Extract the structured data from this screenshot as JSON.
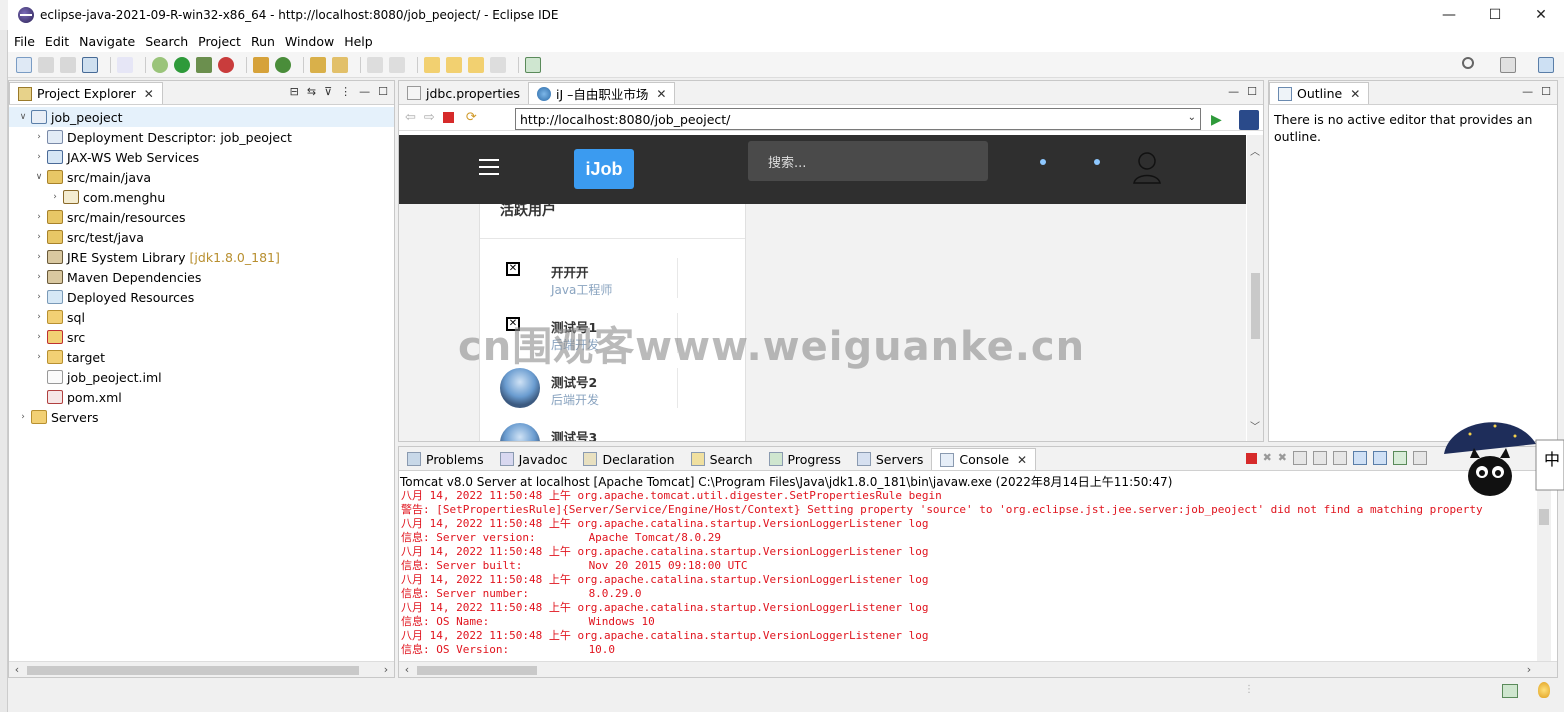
{
  "window": {
    "title": "eclipse-java-2021-09-R-win32-x86_64 - http://localhost:8080/job_peoject/ - Eclipse IDE",
    "minimize": "—",
    "maximize": "☐",
    "close": "✕"
  },
  "menu": [
    "File",
    "Edit",
    "Navigate",
    "Search",
    "Project",
    "Run",
    "Window",
    "Help"
  ],
  "project_explorer": {
    "tab_label": "Project Explorer",
    "items": [
      {
        "label": "job_peoject",
        "depth": 0,
        "expanded": true,
        "selected": true,
        "icon": "web-project-icon"
      },
      {
        "label": "Deployment Descriptor: job_peoject",
        "depth": 1,
        "expanded": false,
        "icon": "deployment-descriptor-icon"
      },
      {
        "label": "JAX-WS Web Services",
        "depth": 1,
        "expanded": false,
        "icon": "web-services-icon"
      },
      {
        "label": "src/main/java",
        "depth": 1,
        "expanded": true,
        "icon": "source-folder-icon"
      },
      {
        "label": "com.menghu",
        "depth": 2,
        "expanded": false,
        "icon": "package-icon"
      },
      {
        "label": "src/main/resources",
        "depth": 1,
        "expanded": false,
        "icon": "source-folder-icon"
      },
      {
        "label": "src/test/java",
        "depth": 1,
        "expanded": false,
        "icon": "source-folder-icon"
      },
      {
        "label": "JRE System Library",
        "suffix": "[jdk1.8.0_181]",
        "depth": 1,
        "expanded": false,
        "icon": "library-icon"
      },
      {
        "label": "Maven Dependencies",
        "depth": 1,
        "expanded": false,
        "icon": "library-icon"
      },
      {
        "label": "Deployed Resources",
        "depth": 1,
        "expanded": false,
        "icon": "deployed-resources-icon"
      },
      {
        "label": "sql",
        "depth": 1,
        "expanded": false,
        "icon": "folder-icon"
      },
      {
        "label": "src",
        "depth": 1,
        "expanded": false,
        "icon": "folder-error-icon"
      },
      {
        "label": "target",
        "depth": 1,
        "expanded": false,
        "icon": "folder-icon"
      },
      {
        "label": "job_peoject.iml",
        "depth": 1,
        "leaf": true,
        "icon": "file-icon"
      },
      {
        "label": "pom.xml",
        "depth": 1,
        "leaf": true,
        "icon": "xml-file-icon"
      },
      {
        "label": "Servers",
        "depth": 0,
        "expanded": false,
        "icon": "folder-icon"
      }
    ]
  },
  "editor": {
    "tabs": [
      {
        "label": "jdbc.properties",
        "active": false
      },
      {
        "label": "iJ –自由职业市场",
        "active": true
      }
    ],
    "url": "http://localhost:8080/job_peoject/",
    "page": {
      "logo": "iJob",
      "search_placeholder": "搜索...",
      "section_title": "活跃用户",
      "users": [
        {
          "name": "开开开",
          "job": "Java工程师",
          "avatar": "broken"
        },
        {
          "name": "测试号1",
          "job": "后端开发",
          "avatar": "broken"
        },
        {
          "name": "测试号2",
          "job": "后端开发",
          "avatar": "photo"
        },
        {
          "name": "测试号3",
          "job": "",
          "avatar": "photo"
        }
      ]
    }
  },
  "outline": {
    "tab_label": "Outline",
    "message": "There is no active editor that provides an outline."
  },
  "bottom": {
    "tabs": [
      "Problems",
      "Javadoc",
      "Declaration",
      "Search",
      "Progress",
      "Servers",
      "Console"
    ],
    "active_tab": "Console",
    "console_header": "Tomcat v8.0 Server at localhost [Apache Tomcat] C:\\Program Files\\Java\\jdk1.8.0_181\\bin\\javaw.exe  (2022年8月14日上午11:50:47)",
    "lines": [
      "八月 14, 2022 11:50:48 上午 org.apache.tomcat.util.digester.SetPropertiesRule begin",
      "警告: [SetPropertiesRule]{Server/Service/Engine/Host/Context} Setting property 'source' to 'org.eclipse.jst.jee.server:job_peoject' did not find a matching property",
      "八月 14, 2022 11:50:48 上午 org.apache.catalina.startup.VersionLoggerListener log",
      "信息: Server version:        Apache Tomcat/8.0.29",
      "八月 14, 2022 11:50:48 上午 org.apache.catalina.startup.VersionLoggerListener log",
      "信息: Server built:          Nov 20 2015 09:18:00 UTC",
      "八月 14, 2022 11:50:48 上午 org.apache.catalina.startup.VersionLoggerListener log",
      "信息: Server number:         8.0.29.0",
      "八月 14, 2022 11:50:48 上午 org.apache.catalina.startup.VersionLoggerListener log",
      "信息: OS Name:               Windows 10",
      "八月 14, 2022 11:50:48 上午 org.apache.catalina.startup.VersionLoggerListener log",
      "信息: OS Version:            10.0"
    ]
  },
  "watermark": "cn围观客www.weiguanke.cn",
  "mascot_badge": "中",
  "colors": {
    "console_error": "#e0141e",
    "accent": "#3b9bf0",
    "web_header": "#2f2f2f"
  }
}
